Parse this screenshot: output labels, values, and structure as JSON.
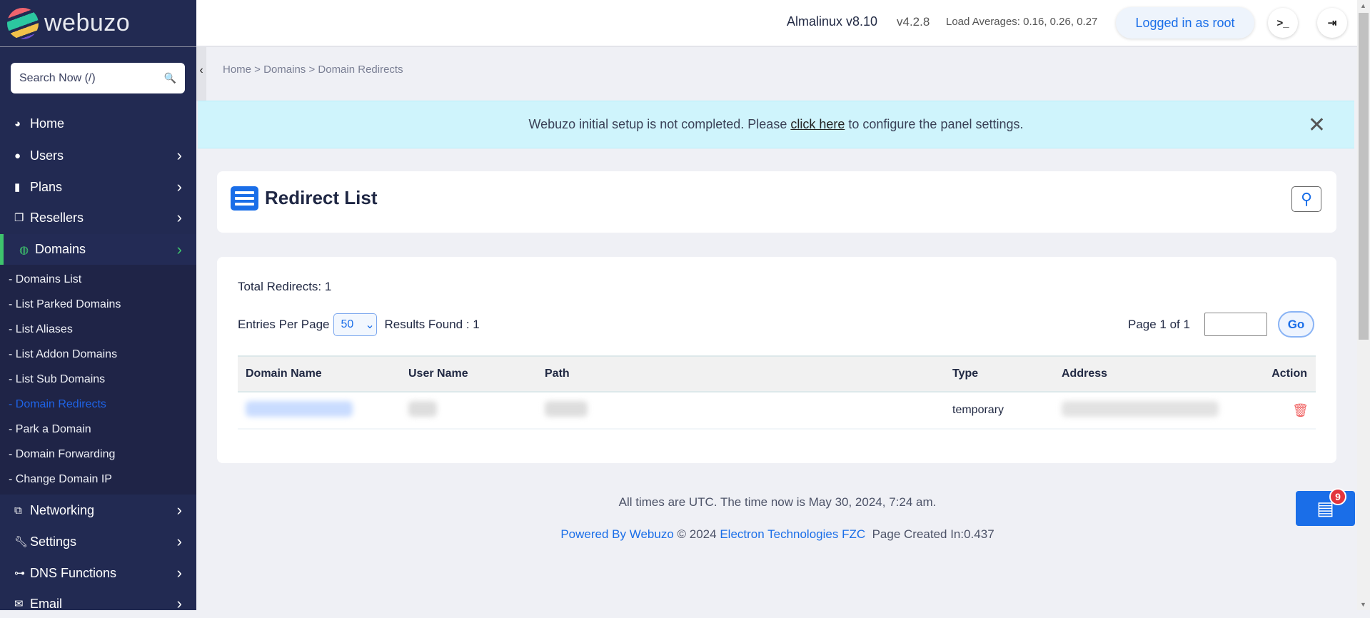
{
  "brand": {
    "name": "webuzo"
  },
  "sidebar": {
    "search_placeholder": "Search Now (/)",
    "items": [
      {
        "label": "Home",
        "icon": "dashboard-icon"
      },
      {
        "label": "Users",
        "icon": "user-icon"
      },
      {
        "label": "Plans",
        "icon": "book-icon"
      },
      {
        "label": "Resellers",
        "icon": "clone-icon"
      },
      {
        "label": "Domains",
        "icon": "globe-icon",
        "active": true
      },
      {
        "label": "Networking",
        "icon": "network-icon"
      },
      {
        "label": "Settings",
        "icon": "wrench-icon"
      },
      {
        "label": "DNS Functions",
        "icon": "sitemap-icon"
      },
      {
        "label": "Email",
        "icon": "envelope-icon"
      }
    ],
    "domains_submenu": [
      "- Domains List",
      "- List Parked Domains",
      "- List Aliases",
      "- List Addon Domains",
      "- List Sub Domains",
      "- Domain Redirects",
      "- Park a Domain",
      "- Domain Forwarding",
      "- Change Domain IP"
    ],
    "selected_sub": "- Domain Redirects"
  },
  "header": {
    "os": "Almalinux v8.10",
    "version": "v4.2.8",
    "load": "Load Averages: 0.16, 0.26, 0.27",
    "login": "Logged in as root"
  },
  "breadcrumb": "Home > Domains > Domain Redirects",
  "alert": {
    "before": "Webuzo initial setup is not completed. Please",
    "link": "click here",
    "after": "to configure the panel settings."
  },
  "page": {
    "title": "Redirect List",
    "total": "Total Redirects: 1",
    "entries_label": "Entries Per Page",
    "entries_value": "50",
    "results": "Results Found : 1",
    "page_info": "Page 1 of 1",
    "go": "Go"
  },
  "table": {
    "headers": [
      "Domain Name",
      "User Name",
      "Path",
      "Type",
      "Address",
      "Action"
    ],
    "rows": [
      {
        "type": "temporary"
      }
    ]
  },
  "footer": {
    "time": "All times are UTC. The time now is May 30, 2024, 7:24 am.",
    "powered": "Powered By Webuzo",
    "copy": "© 2024",
    "company": "Electron Technologies FZC",
    "created": "Page Created In:0.437"
  },
  "notifications": {
    "count": "9"
  },
  "colors": {
    "sidebar": "#222a52",
    "accent": "#1a6ee8",
    "active": "#3ec46d",
    "alert": "#cff4fc",
    "danger": "#f06060"
  }
}
